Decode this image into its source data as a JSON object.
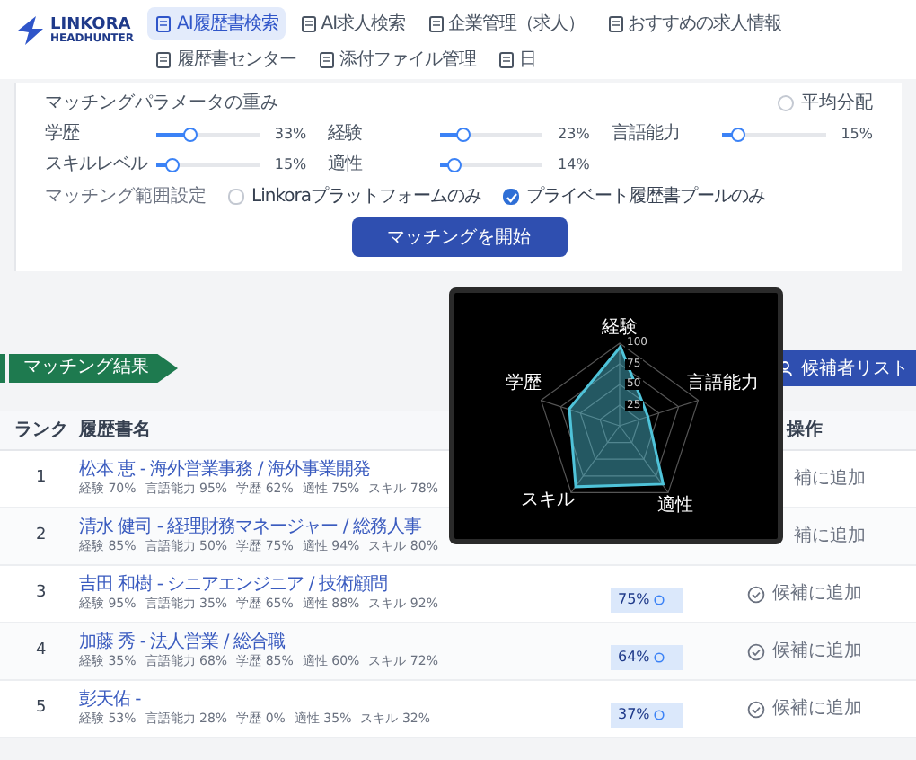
{
  "logo": {
    "line1": "LINKORA",
    "line2": "HEADHUNTER"
  },
  "nav": [
    {
      "label": "AI履歴書検索",
      "selected": true
    },
    {
      "label": "AI求人検索",
      "selected": false
    },
    {
      "label": "企業管理（求人）",
      "selected": false
    },
    {
      "label": "おすすめの求人情報",
      "selected": false
    },
    {
      "label": "履歴書センター",
      "selected": false
    },
    {
      "label": "添付ファイル管理",
      "selected": false
    },
    {
      "label": "日",
      "selected": false
    }
  ],
  "weights": {
    "title": "マッチングパラメータの重み",
    "equal_split": {
      "label": "平均分配",
      "selected": false
    },
    "sliders": [
      {
        "label": "学歴",
        "level": 0.33,
        "reading": "33%"
      },
      {
        "label": "経験",
        "level": 0.23,
        "reading": "23%"
      },
      {
        "label": "言語能力",
        "level": 0.15,
        "reading": "15%"
      },
      {
        "label": "スキルレベル",
        "level": 0.15,
        "reading": "15%"
      },
      {
        "label": "適性",
        "level": 0.14,
        "reading": "14%"
      }
    ]
  },
  "scope": {
    "label": "マッチング範囲設定",
    "options": [
      {
        "label": "Linkoraプラットフォームのみ",
        "checked": false
      },
      {
        "label": "プライベート履歴書プールのみ",
        "checked": true
      }
    ]
  },
  "start_button": "マッチングを開始",
  "results_tag": "マッチング結果",
  "candidate_list_button": "候補者リスト",
  "table": {
    "columns": [
      "ランク",
      "履歴書名",
      "操作"
    ],
    "rows": [
      {
        "rank": "1",
        "name": "松本 恵 - 海外営業事務 / 海外事業開発",
        "metrics": [
          "経験 70%",
          "言語能力 95%",
          "学歴 62%",
          "適性 75%",
          "スキル 78%"
        ],
        "action": "補に追加",
        "icon_visible": false
      },
      {
        "rank": "2",
        "name": "清水 健司 - 経理財務マネージャー / 総務人事",
        "metrics": [
          "経験 85%",
          "言語能力 50%",
          "学歴 75%",
          "適性 94%",
          "スキル 80%"
        ],
        "action": "補に追加",
        "icon_visible": false
      },
      {
        "rank": "3",
        "name": "吉田 和樹 - シニアエンジニア / 技術顧問",
        "metrics": [
          "経験 95%",
          "言語能力 35%",
          "学歴 65%",
          "適性 88%",
          "スキル 92%"
        ],
        "score": "75%",
        "action": "候補に追加",
        "icon_visible": true
      },
      {
        "rank": "4",
        "name": "加藤 秀 - 法人営業 / 総合職",
        "metrics": [
          "経験 35%",
          "言語能力 68%",
          "学歴 85%",
          "適性 60%",
          "スキル 72%"
        ],
        "score": "64%",
        "action": "候補に追加",
        "icon_visible": true
      },
      {
        "rank": "5",
        "name": "彭天佑 -",
        "metrics": [
          "経験 53%",
          "言語能力 28%",
          "学歴 0%",
          "適性 35%",
          "スキル 32%"
        ],
        "score": "37%",
        "action": "候補に追加",
        "icon_visible": true
      }
    ]
  },
  "popup": {
    "chart_data": {
      "type": "radar",
      "categories": [
        "経験",
        "言語能力",
        "適性",
        "スキル",
        "学歴"
      ],
      "series": [
        {
          "color": "#4fc3d9",
          "values": [
            95,
            35,
            88,
            92,
            65
          ]
        }
      ],
      "ylim": [
        0,
        100
      ],
      "yticks": [
        25,
        50,
        75,
        100
      ]
    }
  }
}
